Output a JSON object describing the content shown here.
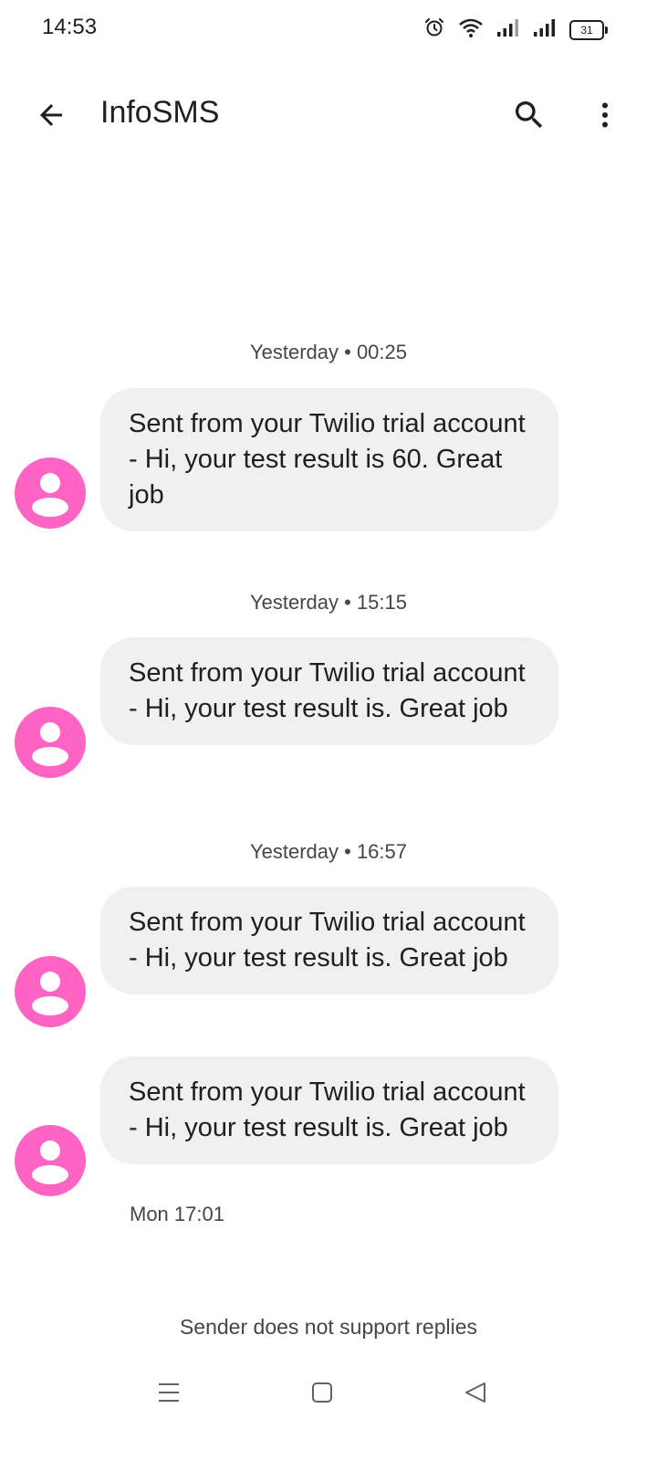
{
  "status_bar": {
    "time": "14:53",
    "battery_level": "31",
    "icons": [
      "alarm-icon",
      "wifi-icon",
      "signal-icon",
      "signal-icon",
      "battery-icon"
    ]
  },
  "app_bar": {
    "title": "InfoSMS",
    "back_icon": "arrow-back-icon",
    "search_icon": "search-icon",
    "more_icon": "more-vert-icon"
  },
  "conversation": {
    "timestamps": [
      "Yesterday • 00:25",
      "Yesterday • 15:15",
      "Yesterday • 16:57"
    ],
    "messages": [
      {
        "text": "Sent from your Twilio trial account - Hi, your test result is 60. Great job"
      },
      {
        "text": "Sent from your Twilio trial account - Hi, your test result is. Great job"
      },
      {
        "text": "Sent from your Twilio trial account - Hi, your test result is. Great job"
      },
      {
        "text": "Sent from your Twilio trial account - Hi, your test result is. Great job"
      }
    ],
    "last_message_time": "Mon 17:01"
  },
  "footer": {
    "no_reply_notice": "Sender does not support replies"
  },
  "nav_bar": {
    "icons": [
      "menu-icon",
      "home-icon",
      "back-icon"
    ]
  },
  "colors": {
    "avatar": "#ff63c3",
    "bubble": "#f0f0f0",
    "text_primary": "#1f1f1f",
    "text_secondary": "#444746"
  }
}
